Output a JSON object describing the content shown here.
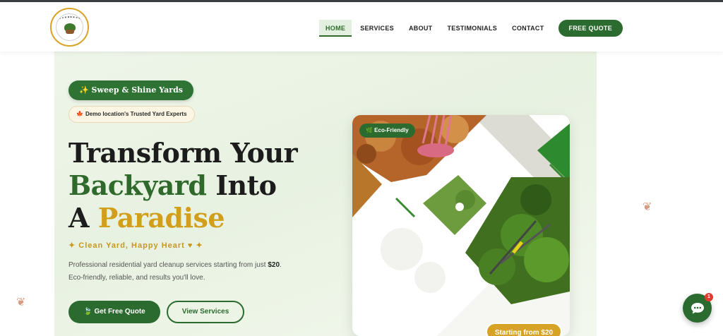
{
  "header": {
    "logo_icon": "yard-logo-icon",
    "nav": [
      {
        "label": "HOME",
        "active": true
      },
      {
        "label": "SERVICES",
        "active": false
      },
      {
        "label": "ABOUT",
        "active": false
      },
      {
        "label": "TESTIMONIALS",
        "active": false
      },
      {
        "label": "CONTACT",
        "active": false
      }
    ],
    "cta_label": "FREE QUOTE"
  },
  "hero": {
    "brand_badge": "✨ Sweep & Shine Yards",
    "location_icon": "🍁",
    "location_badge": "Demo location's Trusted Yard Experts",
    "headline": {
      "line1": "Transform Your",
      "line2_green": "Backyard",
      "line2_rest": " Into",
      "line3_a": "A ",
      "line3_gold": "Paradise"
    },
    "tagline": "✦ Clean Yard, Happy Heart ♥ ✦",
    "description_prefix": "Professional residential yard cleanup services starting from just ",
    "description_price": "$20",
    "description_suffix": ".",
    "description_line2": "Eco-friendly, reliable, and results you'll love.",
    "primary_button": "🍃 Get Free Quote",
    "secondary_button": "View Services"
  },
  "image_card": {
    "eco_badge": "🌿 Eco-Friendly",
    "price_badge": "Starting from $20"
  },
  "chat": {
    "unread_count": "1"
  },
  "colors": {
    "brand_green": "#2c6b2f",
    "accent_gold": "#d29f1c",
    "hero_bg": "#eef5e9"
  }
}
